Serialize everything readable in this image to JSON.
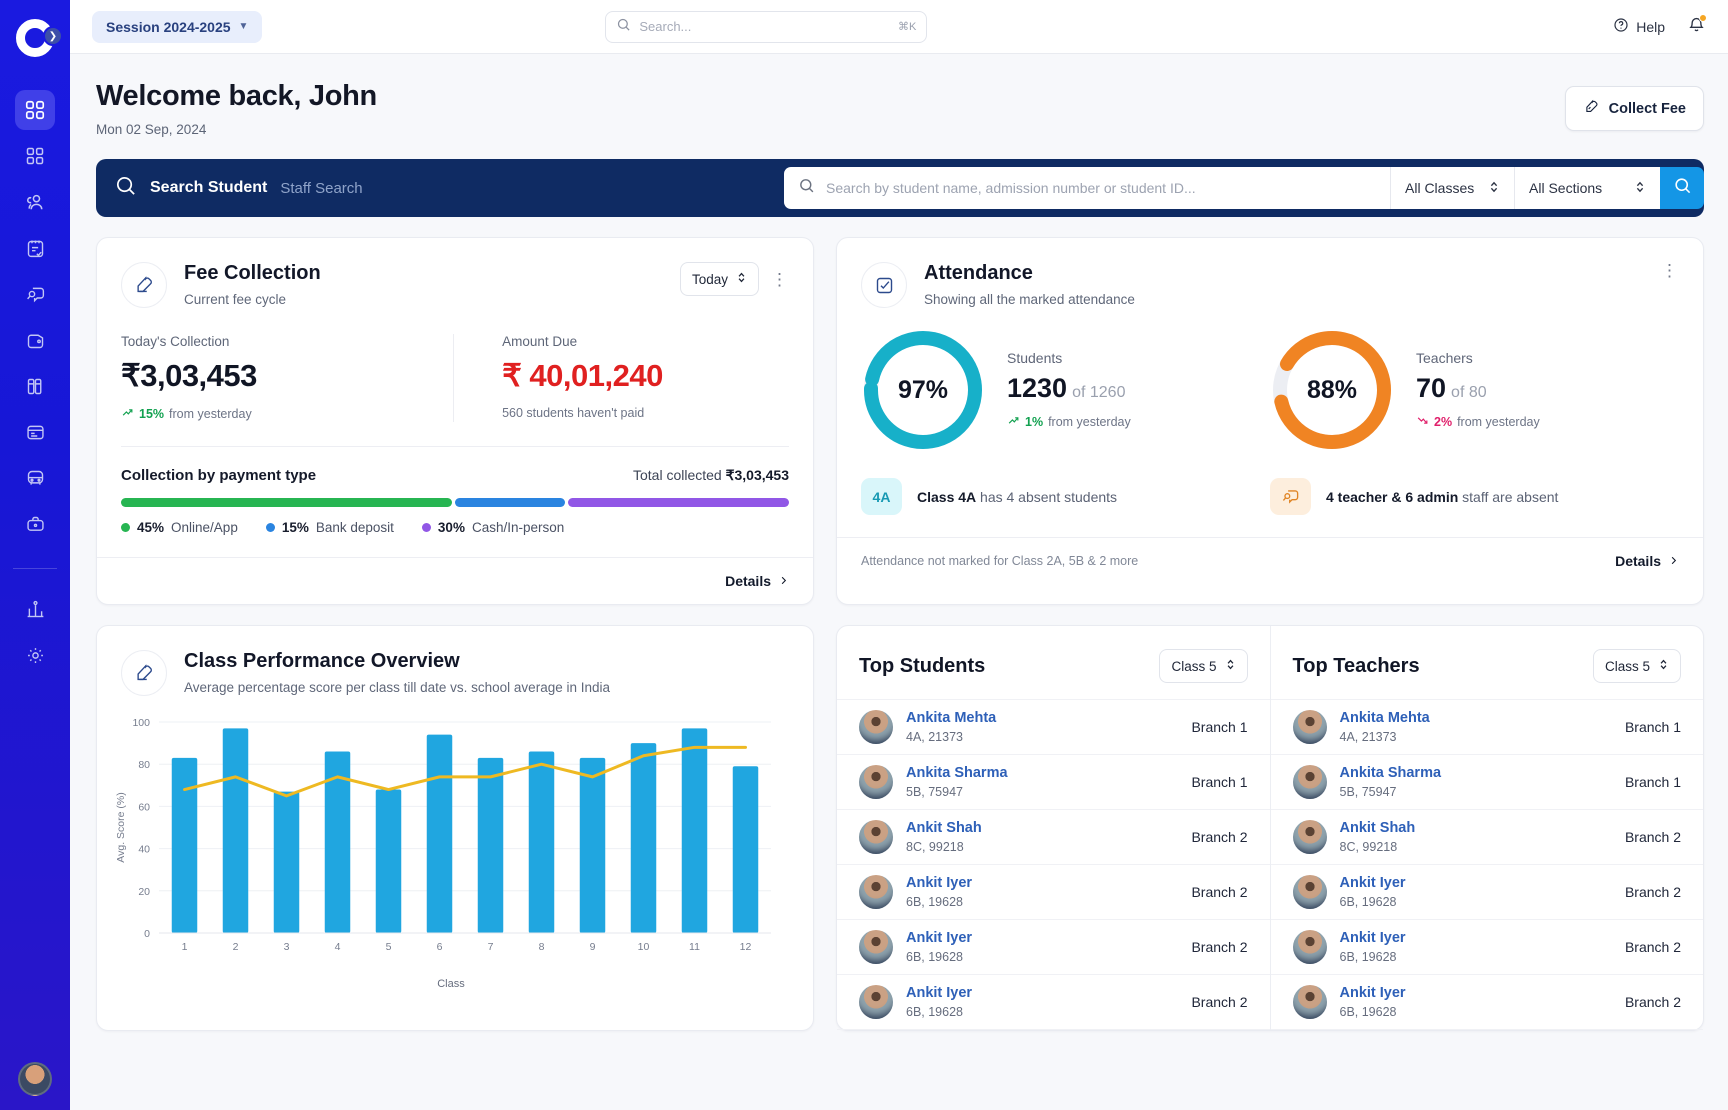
{
  "sidebar": {
    "logo_name": "app-logo",
    "items": [
      {
        "name": "dashboard",
        "icon": "grid-dashboard-icon",
        "active": true
      },
      {
        "name": "modules",
        "icon": "grid-modules-icon",
        "active": false
      },
      {
        "name": "people",
        "icon": "people-icon",
        "active": false
      },
      {
        "name": "tasks",
        "icon": "clipboard-check-icon",
        "active": false
      },
      {
        "name": "messages",
        "icon": "chat-search-icon",
        "active": false
      },
      {
        "name": "fees",
        "icon": "wallet-icon",
        "active": false
      },
      {
        "name": "library",
        "icon": "books-icon",
        "active": false
      },
      {
        "name": "cards",
        "icon": "id-card-icon",
        "active": false
      },
      {
        "name": "transport",
        "icon": "bus-icon",
        "active": false
      },
      {
        "name": "hr",
        "icon": "briefcase-icon",
        "active": false
      },
      {
        "name": "reports",
        "icon": "analytics-icon",
        "active": false
      },
      {
        "name": "settings",
        "icon": "gear-icon",
        "active": false
      }
    ]
  },
  "topbar": {
    "session_label": "Session 2024-2025",
    "search_placeholder": "Search...",
    "search_value": "",
    "shortcut": "⌘K",
    "help_label": "Help",
    "notification_icon": "bell-icon"
  },
  "header": {
    "welcome": "Welcome back, John",
    "date": "Mon 02 Sep, 2024",
    "collect_fee_label": "Collect Fee"
  },
  "search_band": {
    "tab_student": "Search Student",
    "tab_staff": "Staff Search",
    "placeholder": "Search by student name, admission number or student ID...",
    "value": "",
    "class_filter": "All Classes",
    "section_filter": "All Sections"
  },
  "fee_card": {
    "title": "Fee Collection",
    "subtitle": "Current fee cycle",
    "period": "Today",
    "today_label": "Today's Collection",
    "today_amount": "₹3,03,453",
    "today_change": "15%",
    "today_change_note": "from yesterday",
    "due_label": "Amount Due",
    "due_amount": "₹ 40,01,240",
    "due_note": "560 students haven't paid",
    "payment_title": "Collection by payment type",
    "total_prefix": "Total collected ",
    "total_amount": "₹3,03,453",
    "segments": [
      {
        "pct": "45%",
        "label": "Online/App",
        "value": 45,
        "color": "#27b552"
      },
      {
        "pct": "15%",
        "label": "Bank deposit",
        "value": 15,
        "color": "#2a84e0"
      },
      {
        "pct": "30%",
        "label": "Cash/In-person",
        "value": 30,
        "color": "#9157e6"
      }
    ],
    "details_label": "Details"
  },
  "attendance_card": {
    "title": "Attendance",
    "subtitle": "Showing all the marked attendance",
    "students": {
      "percent": "97%",
      "percent_value": 97,
      "label": "Students",
      "count": "1230",
      "of": "of 1260",
      "change": "1%",
      "change_note": "from yesterday",
      "color": "#17b0c9"
    },
    "teachers": {
      "percent": "88%",
      "percent_value": 88,
      "label": "Teachers",
      "count": "70",
      "of": "of 80",
      "change": "2%",
      "change_note": "from yesterday",
      "color": "#f08423"
    },
    "alert_student_chip": "4A",
    "alert_student_bold": "Class 4A",
    "alert_student_rest": " has 4 absent students",
    "alert_staff_bold": "4 teacher & 6 admin",
    "alert_staff_rest": " staff are absent",
    "footer_note": "Attendance not marked for Class 2A, 5B & 2 more",
    "details_label": "Details"
  },
  "chart_card": {
    "title": "Class Performance Overview",
    "subtitle": "Average percentage score per class till date vs. school average in India"
  },
  "chart_data": {
    "type": "bar",
    "title": "Class Performance Overview",
    "subtitle": "Average percentage score per class till date vs. school average in India",
    "categories": [
      "1",
      "2",
      "3",
      "4",
      "5",
      "6",
      "7",
      "8",
      "9",
      "10",
      "11",
      "12"
    ],
    "xlabel": "Class",
    "ylabel": "Avg. Score (%)",
    "ylim": [
      0,
      100
    ],
    "yticks": [
      0,
      20,
      40,
      60,
      80,
      100
    ],
    "grid": true,
    "legend": "none",
    "series": [
      {
        "name": "Class average",
        "type": "bar",
        "color": "#20a6e0",
        "values": [
          83,
          97,
          67,
          86,
          68,
          94,
          83,
          86,
          83,
          90,
          97,
          79
        ]
      },
      {
        "name": "School average in India",
        "type": "line",
        "color": "#eeb922",
        "values": [
          68,
          74,
          65,
          74,
          68,
          74,
          74,
          80,
          74,
          84,
          88,
          88
        ]
      }
    ]
  },
  "top_students": {
    "title": "Top Students",
    "filter": "Class 5",
    "rows": [
      {
        "name": "Ankita Mehta",
        "meta": "4A, 21373",
        "branch": "Branch 1"
      },
      {
        "name": "Ankita Sharma",
        "meta": "5B, 75947",
        "branch": "Branch 1"
      },
      {
        "name": "Ankit Shah",
        "meta": "8C, 99218",
        "branch": "Branch 2"
      },
      {
        "name": "Ankit Iyer",
        "meta": "6B, 19628",
        "branch": "Branch 2"
      },
      {
        "name": "Ankit Iyer",
        "meta": "6B, 19628",
        "branch": "Branch 2"
      },
      {
        "name": "Ankit Iyer",
        "meta": "6B, 19628",
        "branch": "Branch 2"
      }
    ]
  },
  "top_teachers": {
    "title": "Top Teachers",
    "filter": "Class 5",
    "rows": [
      {
        "name": "Ankita Mehta",
        "meta": "4A, 21373",
        "branch": "Branch 1"
      },
      {
        "name": "Ankita Sharma",
        "meta": "5B, 75947",
        "branch": "Branch 1"
      },
      {
        "name": "Ankit Shah",
        "meta": "8C, 99218",
        "branch": "Branch 2"
      },
      {
        "name": "Ankit Iyer",
        "meta": "6B, 19628",
        "branch": "Branch 2"
      },
      {
        "name": "Ankit Iyer",
        "meta": "6B, 19628",
        "branch": "Branch 2"
      },
      {
        "name": "Ankit Iyer",
        "meta": "6B, 19628",
        "branch": "Branch 2"
      }
    ]
  }
}
